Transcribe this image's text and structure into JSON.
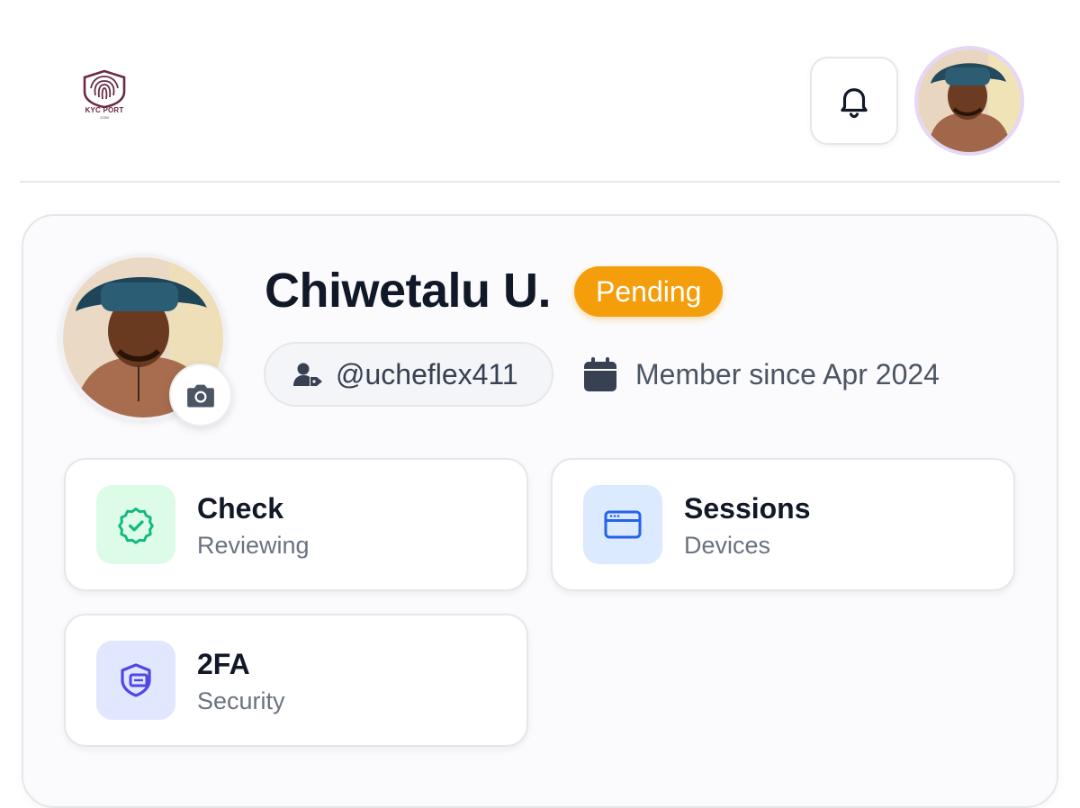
{
  "header": {
    "logo_text": "KYC PORT",
    "logo_sub": "COM",
    "notification_icon": "bell-icon",
    "avatar_icon": "user-avatar"
  },
  "profile": {
    "name": "Chiwetalu U.",
    "status": "Pending",
    "status_color": "#f59e0b",
    "username": "@ucheflex411",
    "member_since": "Member since Apr 2024"
  },
  "tiles": [
    {
      "title": "Check",
      "subtitle": "Reviewing",
      "icon": "badge-check-icon",
      "icon_bg": "#dcfce7",
      "icon_color": "#10b981"
    },
    {
      "title": "Sessions",
      "subtitle": "Devices",
      "icon": "browser-window-icon",
      "icon_bg": "#dbeafe",
      "icon_color": "#2563eb"
    },
    {
      "title": "2FA",
      "subtitle": "Security",
      "icon": "shield-icon",
      "icon_bg": "#e0e7ff",
      "icon_color": "#4f46e5"
    }
  ]
}
